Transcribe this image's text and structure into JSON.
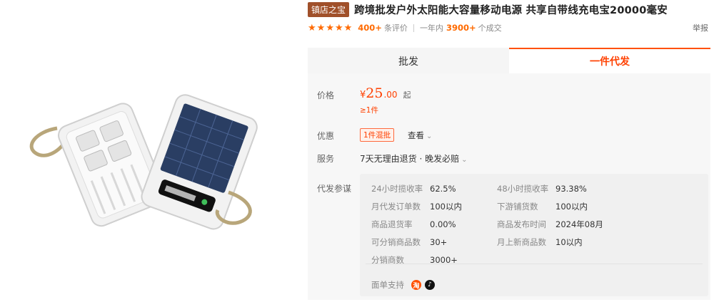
{
  "product": {
    "shop_badge": "镇店之宝",
    "title": "跨境批发户外太阳能大容量移动电源 共享自带线充电宝20000毫安"
  },
  "stats": {
    "rating_stars": 5,
    "reviews_count": "400+",
    "reviews_label": "条评价",
    "period_label": "一年内",
    "sales_count": "3900+",
    "sales_label": "个成交",
    "report_label": "举报"
  },
  "tabs": [
    {
      "label": "批发",
      "active": false
    },
    {
      "label": "一件代发",
      "active": true
    }
  ],
  "price": {
    "label": "价格",
    "currency": "¥",
    "integer": "25",
    "decimal": ".00",
    "unit": "起",
    "moq": "≥1件"
  },
  "promo": {
    "label": "优惠",
    "tag": "1件混批",
    "view_label": "查看"
  },
  "service": {
    "label": "服务",
    "text": "7天无理由退货 · 晚发必赔"
  },
  "dropship_ref": {
    "label": "代发参谋",
    "metrics": [
      {
        "key": "24小时揽收率",
        "value": "62.5%"
      },
      {
        "key": "48小时揽收率",
        "value": "93.38%"
      },
      {
        "key": "月代发订单数",
        "value": "100以内"
      },
      {
        "key": "下游铺货数",
        "value": "100以内"
      },
      {
        "key": "商品退货率",
        "value": "0.00%"
      },
      {
        "key": "商品发布时间",
        "value": "2024年08月"
      },
      {
        "key": "可分销商品数",
        "value": "30+"
      },
      {
        "key": "月上新商品数",
        "value": "10以内"
      },
      {
        "key": "分销商数",
        "value": "3000+"
      }
    ],
    "platform_label": "面单支持",
    "platform_icons": [
      "taobao-icon",
      "douyin-icon"
    ]
  },
  "colors": {
    "accent": "#ff4000",
    "badge": "#a0502a"
  }
}
